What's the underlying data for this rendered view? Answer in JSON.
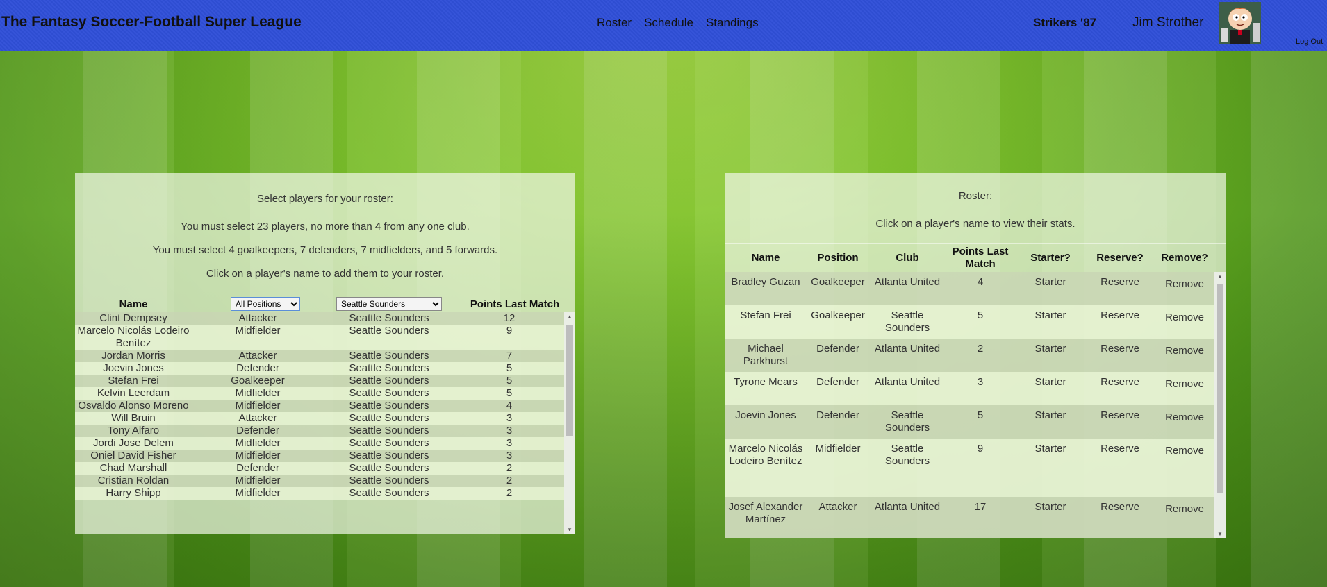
{
  "header": {
    "title": "The Fantasy Soccer-Football Super League",
    "nav": [
      "Roster",
      "Schedule",
      "Standings"
    ],
    "team": "Strikers '87",
    "user": "Jim Strother",
    "logout": "Log Out"
  },
  "colors": {
    "header_bg": "#2f4fd8",
    "grass": "#5fa61e"
  },
  "select_panel": {
    "heading": "Select players for your roster:",
    "line1": "You must select 23 players, no more than 4 from any one club.",
    "line2": "You must select 4 goalkeepers, 7 defenders, 7 midfielders, and 5 forwards.",
    "line3": "Click on a player's name to add them to your roster.",
    "col_name": "Name",
    "position_filter": "All Positions",
    "club_filter": "Seattle Sounders",
    "col_points": "Points Last Match",
    "players": [
      {
        "name": "Clint Dempsey",
        "position": "Attacker",
        "club": "Seattle Sounders",
        "points": "12"
      },
      {
        "name": "Marcelo Nicolás Lodeiro Benítez",
        "position": "Midfielder",
        "club": "Seattle Sounders",
        "points": "9"
      },
      {
        "name": "Jordan Morris",
        "position": "Attacker",
        "club": "Seattle Sounders",
        "points": "7"
      },
      {
        "name": "Joevin Jones",
        "position": "Defender",
        "club": "Seattle Sounders",
        "points": "5"
      },
      {
        "name": "Stefan Frei",
        "position": "Goalkeeper",
        "club": "Seattle Sounders",
        "points": "5"
      },
      {
        "name": "Kelvin Leerdam",
        "position": "Midfielder",
        "club": "Seattle Sounders",
        "points": "5"
      },
      {
        "name": "Osvaldo Alonso Moreno",
        "position": "Midfielder",
        "club": "Seattle Sounders",
        "points": "4"
      },
      {
        "name": "Will Bruin",
        "position": "Attacker",
        "club": "Seattle Sounders",
        "points": "3"
      },
      {
        "name": "Tony Alfaro",
        "position": "Defender",
        "club": "Seattle Sounders",
        "points": "3"
      },
      {
        "name": "Jordi Jose Delem",
        "position": "Midfielder",
        "club": "Seattle Sounders",
        "points": "3"
      },
      {
        "name": "Oniel David Fisher",
        "position": "Midfielder",
        "club": "Seattle Sounders",
        "points": "3"
      },
      {
        "name": "Chad Marshall",
        "position": "Defender",
        "club": "Seattle Sounders",
        "points": "2"
      },
      {
        "name": "Cristian Roldan",
        "position": "Midfielder",
        "club": "Seattle Sounders",
        "points": "2"
      },
      {
        "name": "Harry Shipp",
        "position": "Midfielder",
        "club": "Seattle Sounders",
        "points": "2"
      }
    ]
  },
  "roster_panel": {
    "heading": "Roster:",
    "subtext": "Click on a player's name to view their stats.",
    "columns": [
      "Name",
      "Position",
      "Club",
      "Points Last Match",
      "Starter?",
      "Reserve?",
      "Remove?"
    ],
    "players": [
      {
        "name": "Bradley Guzan",
        "position": "Goalkeeper",
        "club": "Atlanta United",
        "points": "4",
        "starter": "Starter",
        "reserve": "Reserve",
        "remove": "Remove"
      },
      {
        "name": "Stefan Frei",
        "position": "Goalkeeper",
        "club": "Seattle Sounders",
        "points": "5",
        "starter": "Starter",
        "reserve": "Reserve",
        "remove": "Remove"
      },
      {
        "name": "Michael Parkhurst",
        "position": "Defender",
        "club": "Atlanta United",
        "points": "2",
        "starter": "Starter",
        "reserve": "Reserve",
        "remove": "Remove"
      },
      {
        "name": "Tyrone Mears",
        "position": "Defender",
        "club": "Atlanta United",
        "points": "3",
        "starter": "Starter",
        "reserve": "Reserve",
        "remove": "Remove"
      },
      {
        "name": "Joevin Jones",
        "position": "Defender",
        "club": "Seattle Sounders",
        "points": "5",
        "starter": "Starter",
        "reserve": "Reserve",
        "remove": "Remove"
      },
      {
        "name": "Marcelo Nicolás Lodeiro Benítez",
        "position": "Midfielder",
        "club": "Seattle Sounders",
        "points": "9",
        "starter": "Starter",
        "reserve": "Reserve",
        "remove": "Remove"
      },
      {
        "name": "Josef Alexander Martínez",
        "position": "Attacker",
        "club": "Atlanta United",
        "points": "17",
        "starter": "Starter",
        "reserve": "Reserve",
        "remove": "Remove"
      }
    ]
  }
}
